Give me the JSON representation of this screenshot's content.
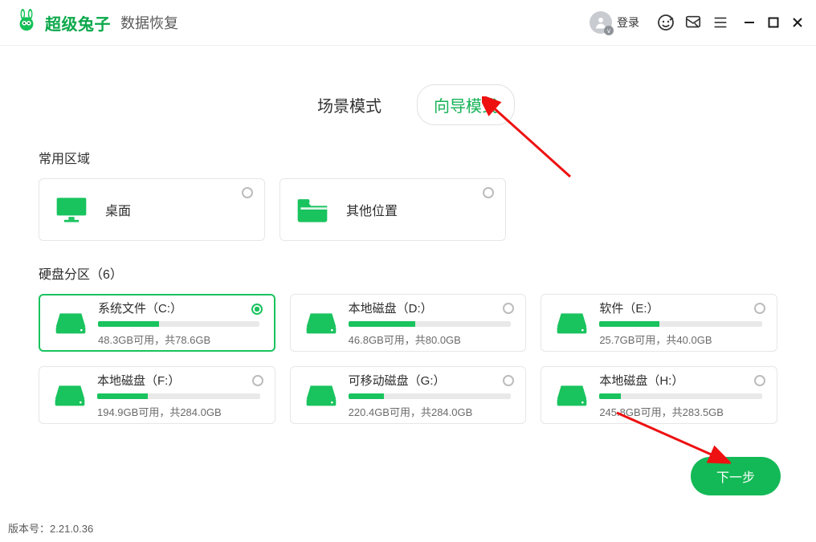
{
  "brand": {
    "name": "超级兔子",
    "sub": "数据恢复"
  },
  "header": {
    "login": "登录"
  },
  "tabs": {
    "mode_scene": "场景模式",
    "mode_wizard": "向导模式"
  },
  "sections": {
    "common_title": "常用区域",
    "common": [
      {
        "label": "桌面"
      },
      {
        "label": "其他位置"
      }
    ],
    "partitions_title": "硬盘分区（6）",
    "partitions": [
      {
        "name": "系统文件（C:）",
        "free": "48.3GB",
        "total": "78.6GB",
        "used_pct": 38
      },
      {
        "name": "本地磁盘（D:）",
        "free": "46.8GB",
        "total": "80.0GB",
        "used_pct": 41
      },
      {
        "name": "软件（E:）",
        "free": "25.7GB",
        "total": "40.0GB",
        "used_pct": 37
      },
      {
        "name": "本地磁盘（F:）",
        "free": "194.9GB",
        "total": "284.0GB",
        "used_pct": 31
      },
      {
        "name": "可移动磁盘（G:）",
        "free": "220.4GB",
        "total": "284.0GB",
        "used_pct": 22
      },
      {
        "name": "本地磁盘（H:）",
        "free": "245.8GB",
        "total": "283.5GB",
        "used_pct": 13
      }
    ]
  },
  "labels": {
    "free_suffix": "可用，共"
  },
  "next": "下一步",
  "version_label": "版本号：",
  "version": "2.21.0.36"
}
